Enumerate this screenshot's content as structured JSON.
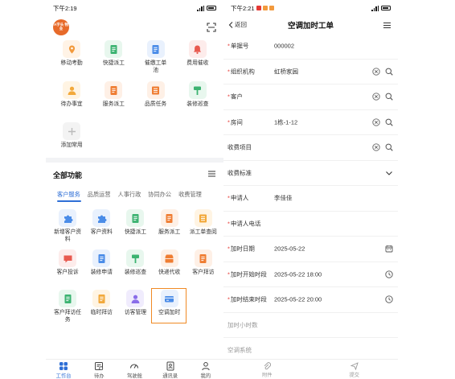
{
  "left": {
    "status": {
      "time": "下午2:19",
      "battery": "100"
    },
    "logo": "A字头 物业",
    "quick": [
      {
        "label": "移动考勤",
        "color": "#f29a3d",
        "bg": "#fff3e6",
        "icon": "location-icon"
      },
      {
        "label": "快捷派工",
        "color": "#3cb371",
        "bg": "#e8f7ee",
        "icon": "doc-icon"
      },
      {
        "label": "催缴工单池",
        "color": "#4a8ce8",
        "bg": "#e9f1fd",
        "icon": "doc-icon"
      },
      {
        "label": "费用催收",
        "color": "#e85a4f",
        "bg": "#fdeceb",
        "icon": "bell-icon"
      },
      {
        "label": "待办事宜",
        "color": "#f2a93b",
        "bg": "#fff4e3",
        "icon": "user-icon"
      },
      {
        "label": "服务派工",
        "color": "#ef7d32",
        "bg": "#fef0e6",
        "icon": "doc-icon"
      },
      {
        "label": "品质任务",
        "color": "#ef7d32",
        "bg": "#fef0e6",
        "icon": "list-icon"
      },
      {
        "label": "装修巡查",
        "color": "#3cb371",
        "bg": "#e8f7ee",
        "icon": "brush-icon"
      },
      {
        "label": "添加常用",
        "color": "#bbbbbb",
        "bg": "#f3f3f3",
        "icon": "plus-icon"
      }
    ],
    "section_title": "全部功能",
    "tabs": [
      "客户服务",
      "品质运营",
      "人事行政",
      "协同办公",
      "收费管理"
    ],
    "funcs": [
      {
        "label": "新增客户资料",
        "color": "#4a8ce8",
        "bg": "#e9f1fd",
        "icon": "puzzle-icon"
      },
      {
        "label": "客户资料",
        "color": "#4a8ce8",
        "bg": "#e9f1fd",
        "icon": "puzzle-icon"
      },
      {
        "label": "快捷派工",
        "color": "#3cb371",
        "bg": "#e8f7ee",
        "icon": "doc-icon"
      },
      {
        "label": "服务派工",
        "color": "#ef7d32",
        "bg": "#fef0e6",
        "icon": "doc-icon"
      },
      {
        "label": "派工单查阅",
        "color": "#f2a93b",
        "bg": "#fff4e3",
        "icon": "list-icon"
      },
      {
        "label": "客户投诉",
        "color": "#e85a4f",
        "bg": "#fdeceb",
        "icon": "chat-icon"
      },
      {
        "label": "装修申请",
        "color": "#4a8ce8",
        "bg": "#e9f1fd",
        "icon": "doc-icon"
      },
      {
        "label": "装修巡查",
        "color": "#3cb371",
        "bg": "#e8f7ee",
        "icon": "brush-icon"
      },
      {
        "label": "快递代收",
        "color": "#ef7d32",
        "bg": "#fef0e6",
        "icon": "box-icon"
      },
      {
        "label": "客户拜访",
        "color": "#ef7d32",
        "bg": "#fef0e6",
        "icon": "doc-icon"
      },
      {
        "label": "客户拜访任务",
        "color": "#3cb371",
        "bg": "#e8f7ee",
        "icon": "doc-icon"
      },
      {
        "label": "临时拜访",
        "color": "#f2a93b",
        "bg": "#fff4e3",
        "icon": "doc-icon"
      },
      {
        "label": "访客管理",
        "color": "#8a6de9",
        "bg": "#f0ecfd",
        "icon": "user-icon"
      },
      {
        "label": "空调加时",
        "color": "#4a8ce8",
        "bg": "#e9f1fd",
        "icon": "card-icon"
      }
    ],
    "nav": [
      {
        "label": "工作台",
        "icon": "grid-icon",
        "active": true
      },
      {
        "label": "待办",
        "icon": "todo-icon",
        "active": false
      },
      {
        "label": "驾驶舱",
        "icon": "gauge-icon",
        "active": false
      },
      {
        "label": "通讯录",
        "icon": "contacts-icon",
        "active": false
      },
      {
        "label": "我的",
        "icon": "person-icon",
        "active": false
      }
    ]
  },
  "right": {
    "status": {
      "time": "下午2:21",
      "battery": "100"
    },
    "back": "返回",
    "title": "空调加时工单",
    "rows": [
      {
        "key": "单据号",
        "req": true,
        "val": "000002",
        "a1": "",
        "a2": ""
      },
      {
        "key": "组织机构",
        "req": true,
        "val": "虹桥家园",
        "a1": "clear",
        "a2": "search"
      },
      {
        "key": "客户",
        "req": true,
        "val": "",
        "a1": "clear",
        "a2": "search"
      },
      {
        "key": "房间",
        "req": true,
        "val": "1栋-1-12",
        "a1": "clear",
        "a2": "search"
      },
      {
        "key": "收费项目",
        "req": false,
        "val": "",
        "a1": "clear",
        "a2": "search"
      },
      {
        "key": "收费标准",
        "req": false,
        "val": "",
        "a1": "",
        "a2": "chevron"
      },
      {
        "key": "申请人",
        "req": true,
        "val": "李佳佳",
        "a1": "",
        "a2": ""
      },
      {
        "key": "申请人电话",
        "req": true,
        "val": "",
        "a1": "",
        "a2": ""
      },
      {
        "key": "加时日期",
        "req": true,
        "val": "2025-05-22",
        "a1": "",
        "a2": "calendar"
      },
      {
        "key": "加时开始时段",
        "req": true,
        "val": "2025-05-22 18:00",
        "a1": "",
        "a2": "clock"
      },
      {
        "key": "加时结束时段",
        "req": true,
        "val": "2025-05-22 20:00",
        "a1": "",
        "a2": "clock"
      },
      {
        "key": "加时小时数",
        "req": false,
        "gray": true,
        "val": "",
        "a1": "",
        "a2": ""
      },
      {
        "key": "空调系统",
        "req": false,
        "gray": true,
        "val": "",
        "a1": "",
        "a2": ""
      }
    ],
    "bottom": [
      {
        "label": "附件",
        "icon": "clip-icon"
      },
      {
        "label": "提交",
        "icon": "send-icon"
      }
    ]
  }
}
